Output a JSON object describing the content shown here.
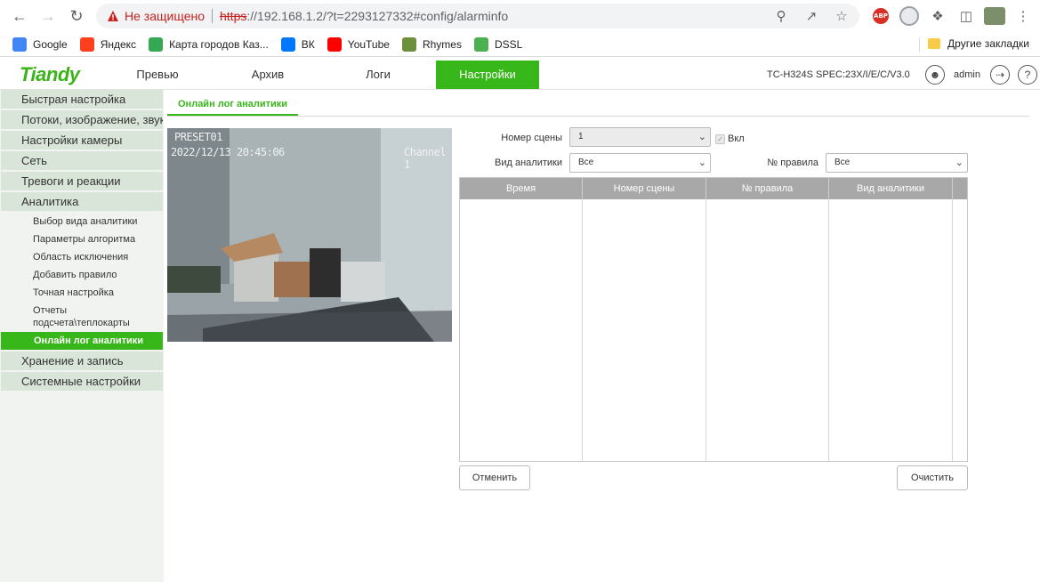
{
  "browser": {
    "not_secure_label": "Не защищено",
    "url_scheme": "https",
    "url_rest": "://192.168.1.2/?t=2293127332#config/alarminfo",
    "abp_label": "ABP",
    "bookmarks": [
      {
        "label": "Google",
        "icon": "google-icon",
        "color": "#4285f4"
      },
      {
        "label": "Яндекс",
        "icon": "yandex-icon",
        "color": "#fc3f1d"
      },
      {
        "label": "Карта городов Каз...",
        "icon": "map-icon",
        "color": "#34a853"
      },
      {
        "label": "ВК",
        "icon": "vk-icon",
        "color": "#0077ff"
      },
      {
        "label": "YouTube",
        "icon": "youtube-icon",
        "color": "#ff0000"
      },
      {
        "label": "Rhymes",
        "icon": "rhymes-icon",
        "color": "#6d8f3b"
      },
      {
        "label": "DSSL",
        "icon": "dssl-icon",
        "color": "#4caf50"
      }
    ],
    "other_bookmarks": "Другие закладки"
  },
  "header": {
    "logo": "Tiandy",
    "tabs": [
      "Превью",
      "Архив",
      "Логи",
      "Настройки"
    ],
    "active_tab": "Настройки",
    "model": "TC-H324S SPEC:23X/I/E/C/V3.0",
    "user": "admin",
    "accent_color": "#38b71a"
  },
  "sidebar": {
    "items": [
      {
        "label": "Быстрая настройка"
      },
      {
        "label": "Потоки, изображение, звук"
      },
      {
        "label": "Настройки камеры"
      },
      {
        "label": "Сеть"
      },
      {
        "label": "Тревоги и реакции"
      },
      {
        "label": "Аналитика"
      }
    ],
    "sub_items": [
      {
        "label": "Выбор вида аналитики"
      },
      {
        "label": "Параметры алгоритма"
      },
      {
        "label": "Область исключения"
      },
      {
        "label": "Добавить правило"
      },
      {
        "label": "Точная настройка"
      },
      {
        "label": "Отчеты подсчета\\теплокарты"
      },
      {
        "label": "Онлайн лог аналитики",
        "active": true
      }
    ],
    "items_after": [
      {
        "label": "Хранение и запись"
      },
      {
        "label": "Системные настройки"
      }
    ]
  },
  "content": {
    "sub_tab": "Онлайн лог аналитики",
    "video": {
      "preset": "PRESET01",
      "datetime": "2022/12/13 20:45:06",
      "channel": "Channel 1"
    },
    "scene_label": "Номер сцены",
    "scene_value": "1",
    "enable_label": "Вкл",
    "analytics_type_label": "Вид аналитики",
    "analytics_type_value": "Все",
    "rule_label": "№ правила",
    "rule_value": "Все",
    "table_headers": [
      "Время",
      "Номер сцены",
      "№ правила",
      "Вид аналитики"
    ],
    "table_rows": [],
    "cancel_button": "Отменить",
    "clear_button": "Очистить"
  }
}
